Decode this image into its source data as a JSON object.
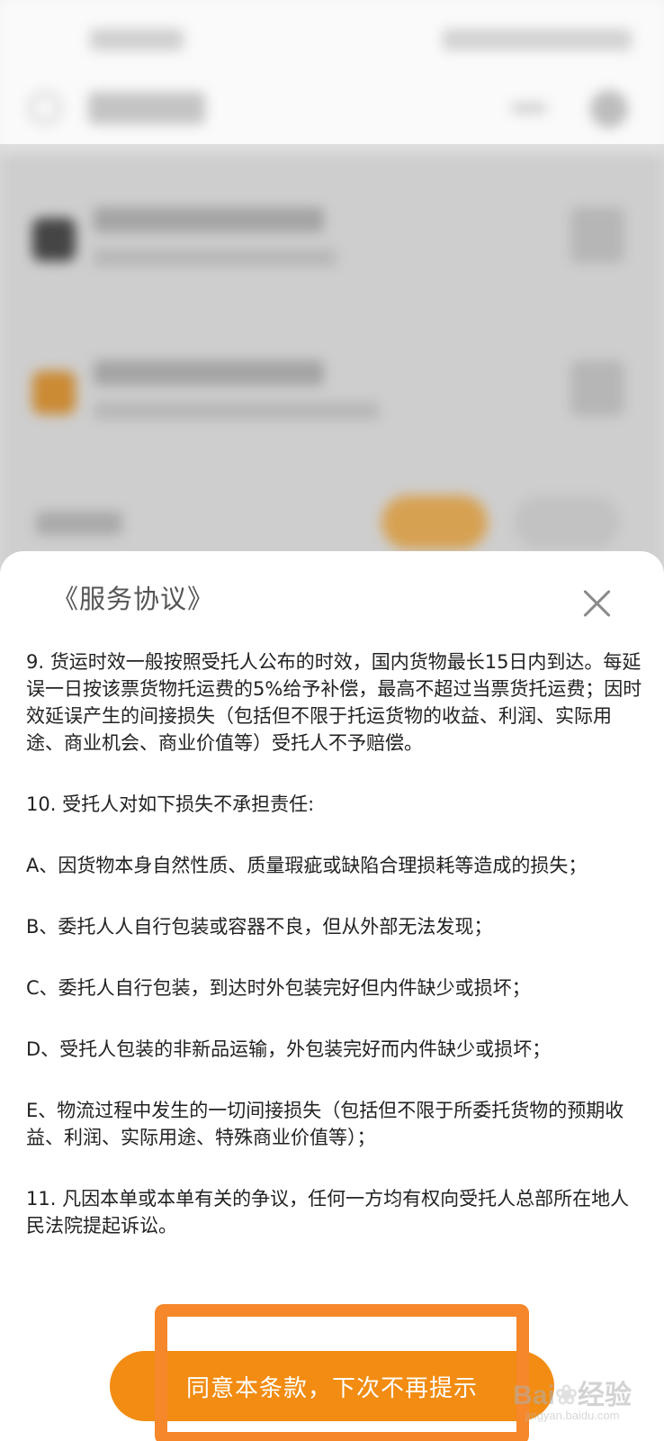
{
  "dialog": {
    "title": "《服务协议》",
    "close_icon": "close-icon"
  },
  "terms": [
    "9. 货运时效一般按照受托人公布的时效，国内货物最长15日内到达。每延误一日按该票货物托运费的5%给予补偿，最高不超过当票货托运费；因时效延误产生的间接损失（包括但不限于托运货物的收益、利润、实际用途、商业机会、商业价值等）受托人不予赔偿。",
    "10. 受托人对如下损失不承担责任:",
    "A、因货物本身自然性质、质量瑕疵或缺陷合理损耗等造成的损失；",
    "B、委托人人自行包装或容器不良，但从外部无法发现；",
    "C、委托人自行包装，到达时外包装完好但内件缺少或损坏；",
    "D、受托人包装的非新品运输，外包装完好而内件缺少或损坏；",
    "E、物流过程中发生的一切间接损失（包括但不限于所委托货物的预期收益、利润、实际用途、特殊商业价值等）；",
    "11. 凡因本单或本单有关的争议，任何一方均有权向受托人总部所在地人民法院提起诉讼。"
  ],
  "agree_button": "同意本条款，下次不再提示",
  "colors": {
    "accent": "#f28c12",
    "highlight": "#f6872a"
  }
}
